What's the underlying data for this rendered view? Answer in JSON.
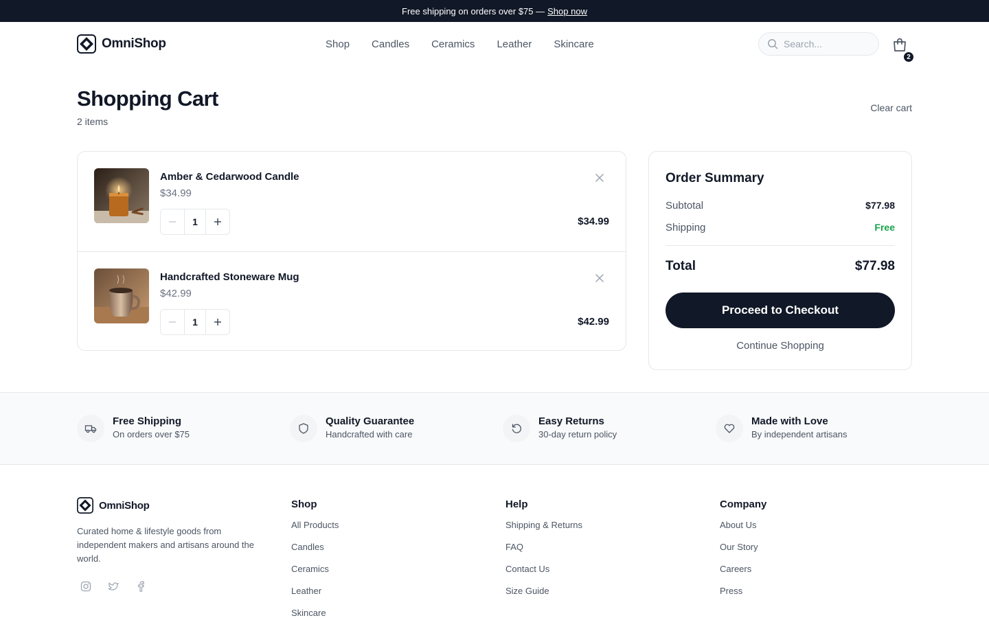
{
  "announcement": {
    "text": "Free shipping on orders over $75 —",
    "link": "Shop now"
  },
  "header": {
    "brand": "OmniShop",
    "nav": [
      "Shop",
      "Candles",
      "Ceramics",
      "Leather",
      "Skincare"
    ],
    "search_placeholder": "Search...",
    "cart_count": "2"
  },
  "cart": {
    "title": "Shopping Cart",
    "item_count": "2 items",
    "clear_label": "Clear cart",
    "items": [
      {
        "name": "Amber & Cedarwood Candle",
        "price": "$34.99",
        "quantity": "1",
        "line_total": "$34.99",
        "image": "candle-photo"
      },
      {
        "name": "Handcrafted Stoneware Mug",
        "price": "$42.99",
        "quantity": "1",
        "line_total": "$42.99",
        "image": "mug-photo"
      }
    ]
  },
  "summary": {
    "title": "Order Summary",
    "subtotal_label": "Subtotal",
    "subtotal_value": "$77.98",
    "shipping_label": "Shipping",
    "shipping_value": "Free",
    "total_label": "Total",
    "total_value": "$77.98",
    "checkout_label": "Proceed to Checkout",
    "continue_label": "Continue Shopping"
  },
  "features": [
    {
      "title": "Free Shipping",
      "subtitle": "On orders over $75",
      "icon": "truck-icon"
    },
    {
      "title": "Quality Guarantee",
      "subtitle": "Handcrafted with care",
      "icon": "shield-icon"
    },
    {
      "title": "Easy Returns",
      "subtitle": "30-day return policy",
      "icon": "rotate-icon"
    },
    {
      "title": "Made with Love",
      "subtitle": "By independent artisans",
      "icon": "heart-icon"
    }
  ],
  "footer": {
    "brand": "OmniShop",
    "description": "Curated home & lifestyle goods from independent makers and artisans around the world.",
    "socials": [
      "instagram-icon",
      "twitter-icon",
      "facebook-icon"
    ],
    "columns": [
      {
        "title": "Shop",
        "links": [
          "All Products",
          "Candles",
          "Ceramics",
          "Leather",
          "Skincare"
        ]
      },
      {
        "title": "Help",
        "links": [
          "Shipping & Returns",
          "FAQ",
          "Contact Us",
          "Size Guide"
        ]
      },
      {
        "title": "Company",
        "links": [
          "About Us",
          "Our Story",
          "Careers",
          "Press"
        ]
      }
    ]
  },
  "colors": {
    "primary": "#111827",
    "muted": "#4b5563",
    "border": "#e5e7eb",
    "success": "#16a34a",
    "band": "#f9fafb"
  }
}
